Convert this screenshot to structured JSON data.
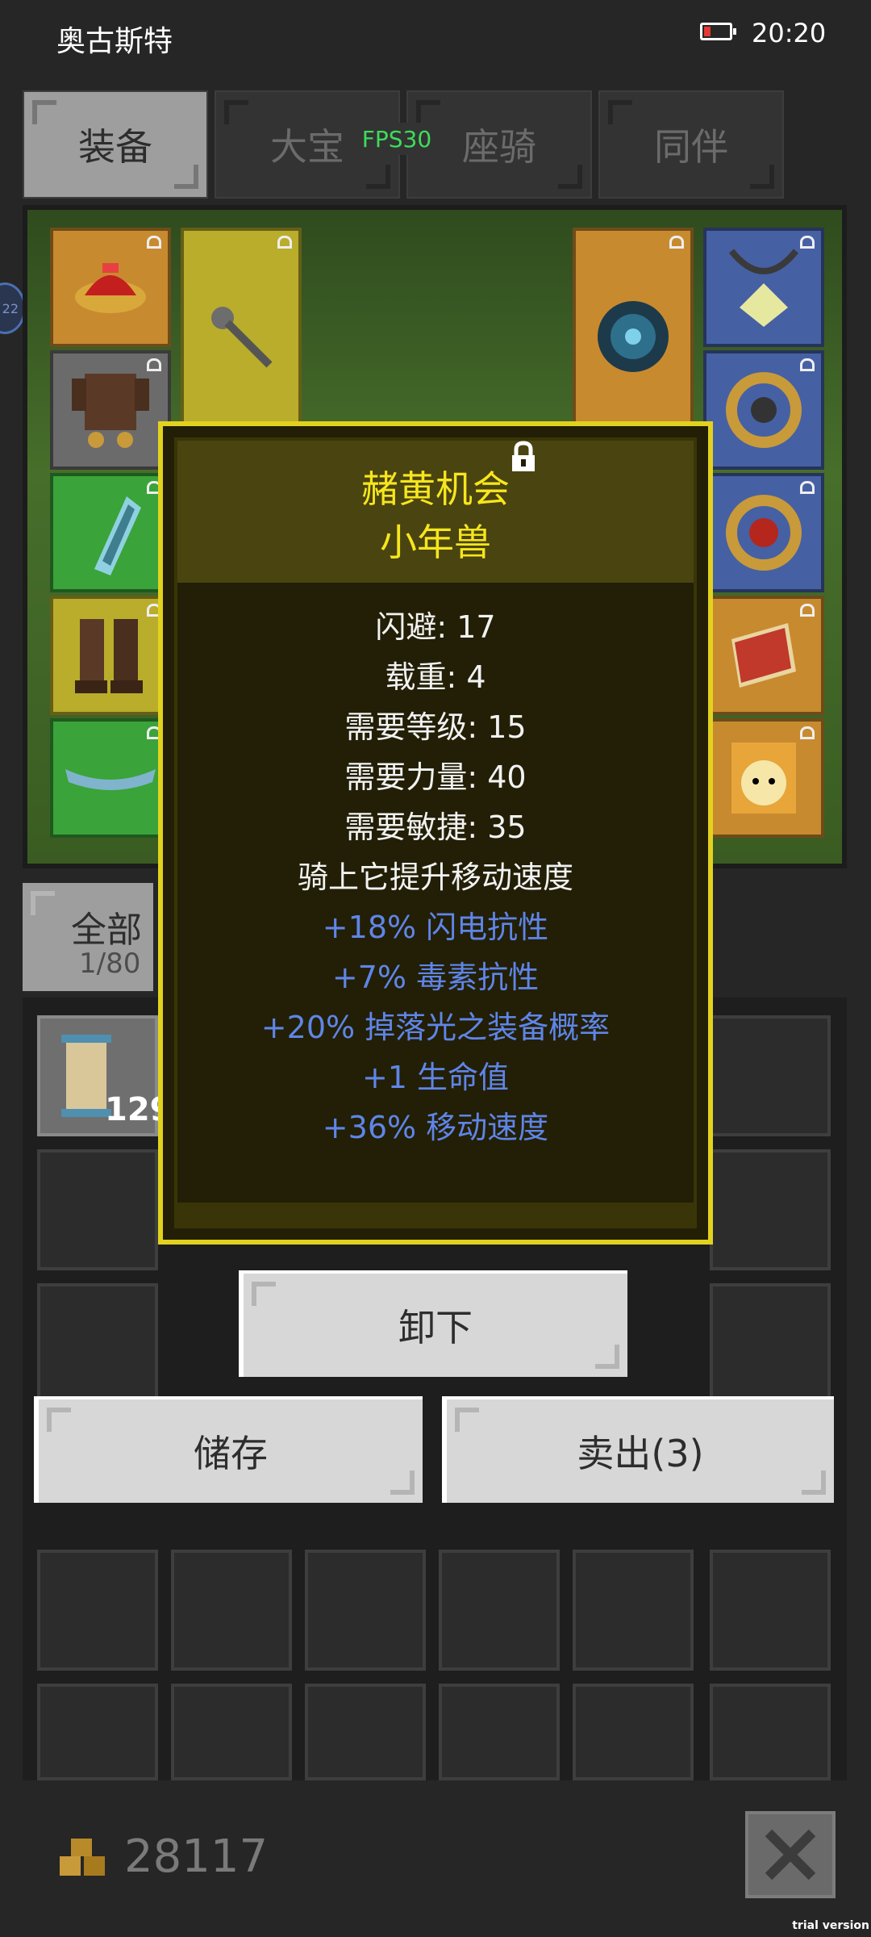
{
  "status_bar": {
    "title": "奥古斯特",
    "time": "20:20",
    "battery_icon": "battery-low-icon"
  },
  "tabs": [
    {
      "label": "装备",
      "active": true
    },
    {
      "label": "大宝",
      "active": false
    },
    {
      "label": "座骑",
      "active": false
    },
    {
      "label": "同伴",
      "active": false
    }
  ],
  "fps_badge": "FPS30",
  "side_bubble": "22",
  "tooltip": {
    "name": "赭黄机会",
    "subtitle": "小年兽",
    "lock_icon": "lock-icon",
    "stats": [
      "闪避: 17",
      "载重: 4",
      "需要等级: 15",
      "需要力量: 40",
      "需要敏捷: 35",
      "骑上它提升移动速度"
    ],
    "bonuses": [
      "+18% 闪电抗性",
      "+7% 毒素抗性",
      "+20% 掉落光之装备概率",
      "+1 生命值",
      "+36% 移动速度"
    ],
    "colors": {
      "title": "#f6e61d",
      "stat": "#f2f2f2",
      "bonus": "#5f85e8",
      "border": "#e2d21e"
    }
  },
  "filter": {
    "label": "全部",
    "count": "1/80"
  },
  "inventory": {
    "first_item_count": "129",
    "first_item_icon": "scroll-icon"
  },
  "buttons": {
    "unequip": "卸下",
    "store": "储存",
    "sell": "卖出(3)"
  },
  "gold": {
    "value": "28117",
    "icon": "gold-coins-icon"
  },
  "close_icon": "close-icon",
  "watermark": "trial version"
}
